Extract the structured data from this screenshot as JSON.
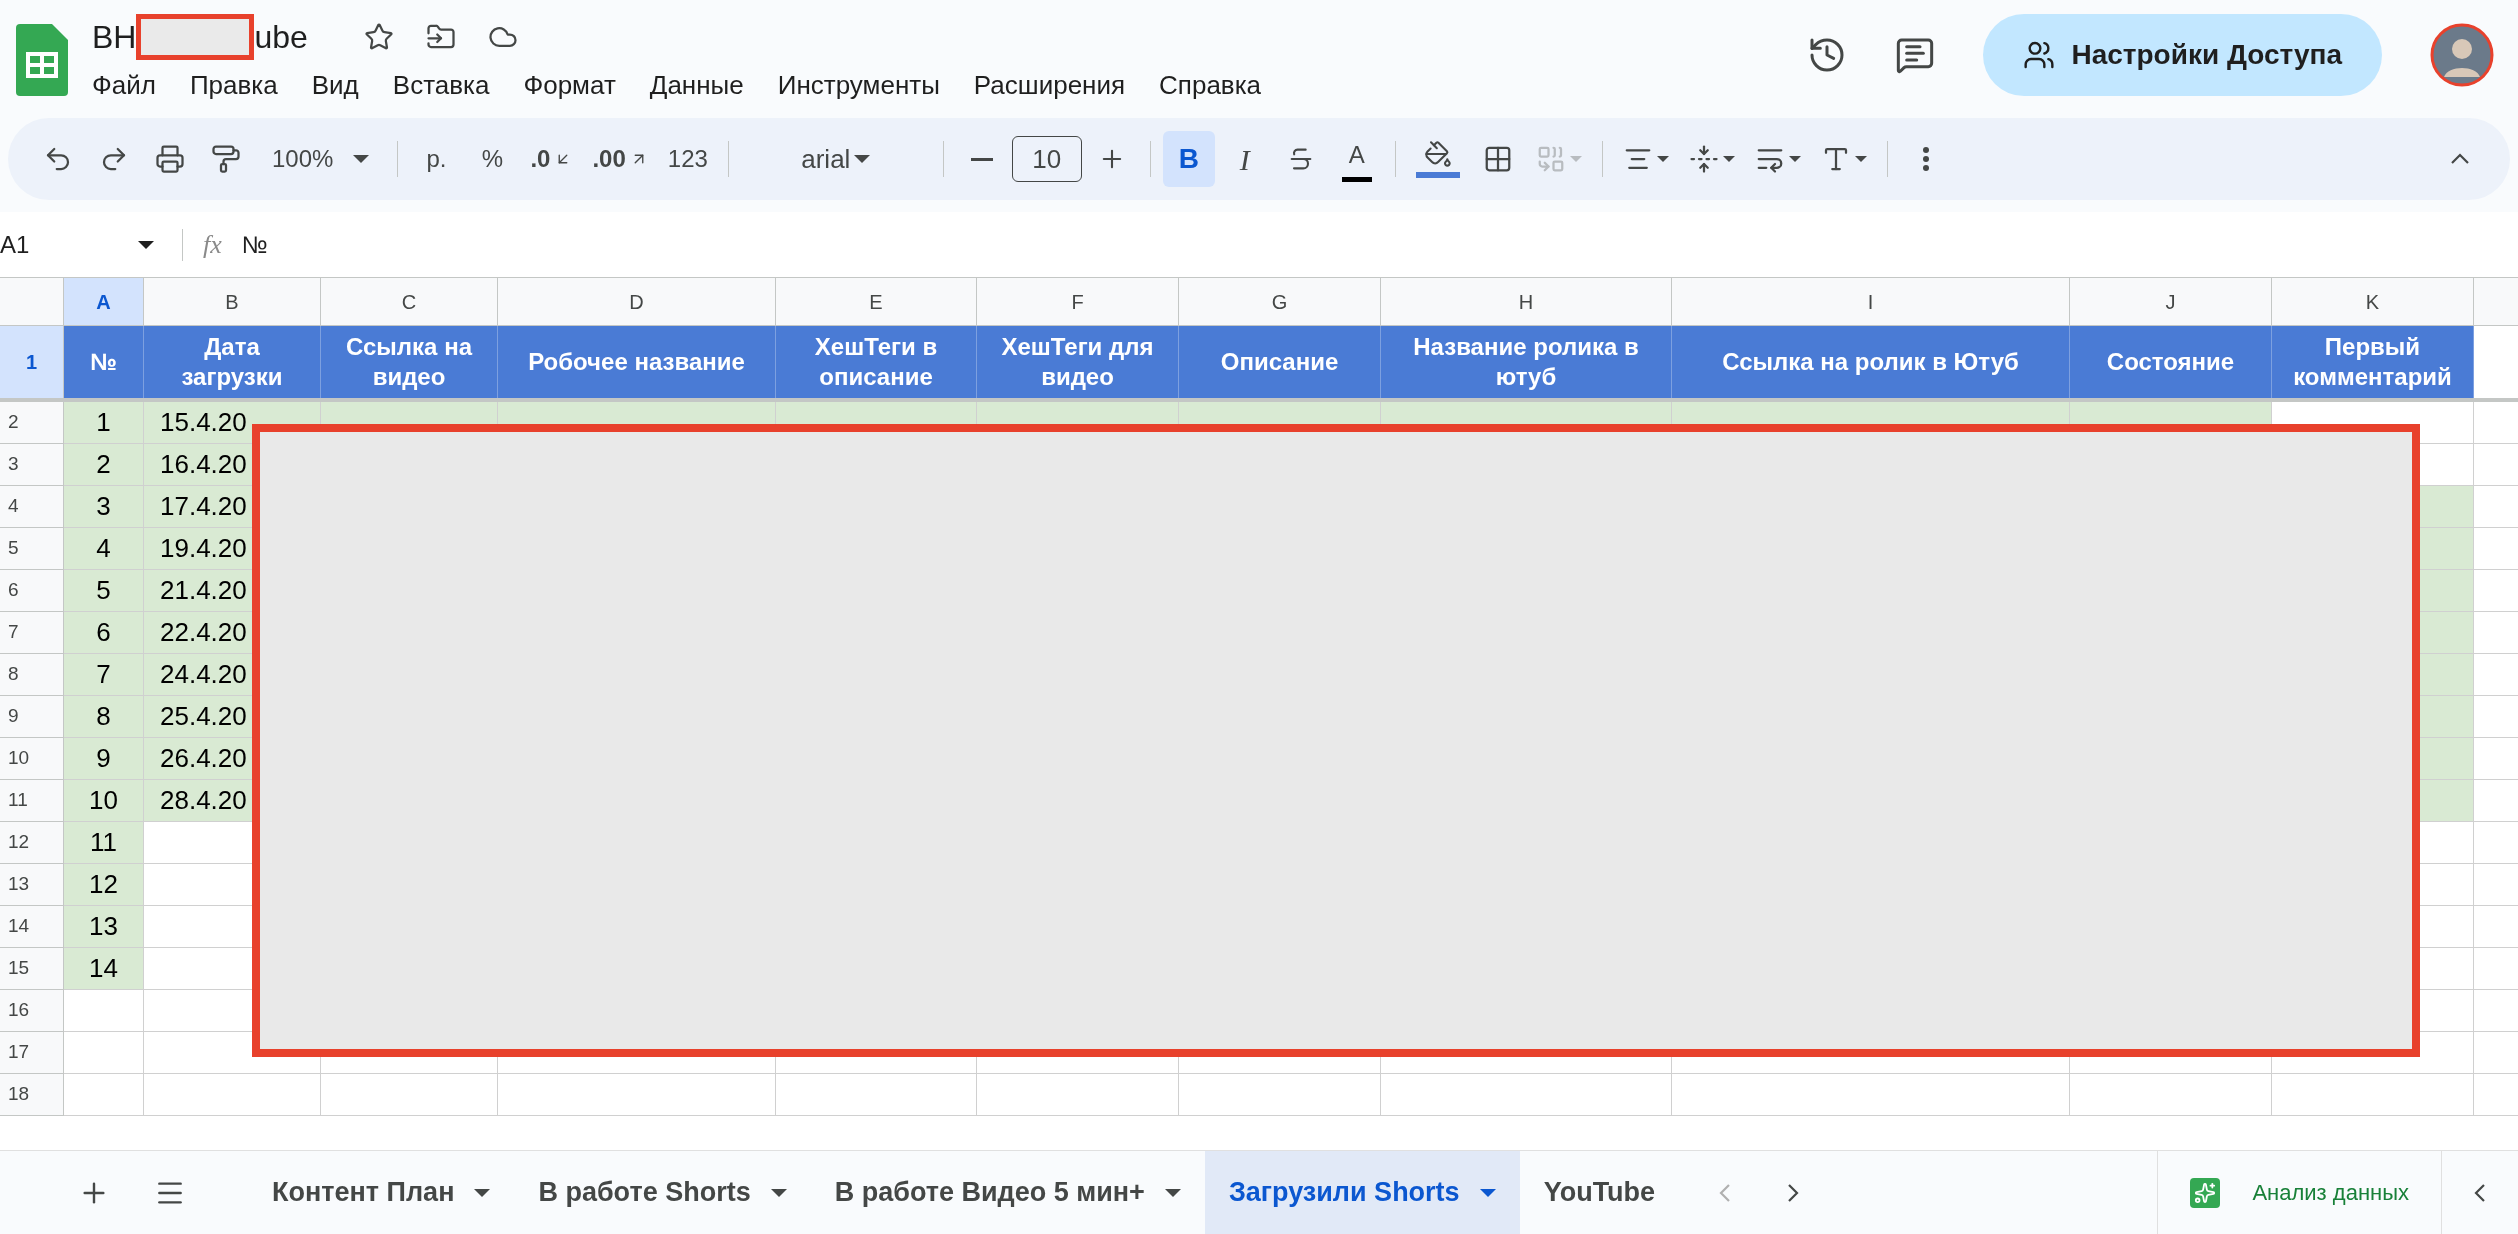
{
  "document": {
    "title_parts": [
      "BH",
      "ube"
    ],
    "redacted": true
  },
  "menu": [
    "Файл",
    "Правка",
    "Вид",
    "Вставка",
    "Формат",
    "Данные",
    "Инструменты",
    "Расширения",
    "Справка"
  ],
  "share_button": "Настройки Доступа",
  "toolbar": {
    "zoom": "100%",
    "currency": "р.",
    "percent": "%",
    "decrease_decimal": ".0",
    "increase_decimal": ".00",
    "number_format": "123",
    "font": "arial",
    "font_size": "10",
    "bold": {
      "label": "B",
      "on": true
    },
    "italic": "I",
    "text_color": "A",
    "merge_disabled": true
  },
  "formula_bar": {
    "cell": "A1",
    "fx": "fx",
    "value": "№"
  },
  "columns": [
    {
      "label": "A",
      "selected": true
    },
    {
      "label": "B",
      "selected": false
    },
    {
      "label": "C",
      "selected": false
    },
    {
      "label": "D",
      "selected": false
    },
    {
      "label": "E",
      "selected": false
    },
    {
      "label": "F",
      "selected": false
    },
    {
      "label": "G",
      "selected": false
    },
    {
      "label": "H",
      "selected": false
    },
    {
      "label": "I",
      "selected": false
    },
    {
      "label": "J",
      "selected": false
    },
    {
      "label": "K",
      "selected": false
    }
  ],
  "header_row": {
    "number": "1",
    "selected": true,
    "cells": [
      "№",
      "Дата загрузки",
      "Ссылка на видео",
      "Робочее название",
      "ХешТеги в описание",
      "ХешТеги для видео",
      "Описание",
      "Название ролика в ютуб",
      "Ссылка на ролик в Ютуб",
      "Состояние",
      "Первый комментарий"
    ]
  },
  "rows": [
    {
      "number": "2",
      "kind": "partial",
      "cells": [
        "1",
        "15.4.20"
      ]
    },
    {
      "number": "3",
      "kind": "partial",
      "cells": [
        "2",
        "16.4.20"
      ]
    },
    {
      "number": "4",
      "kind": "full",
      "cells": [
        "3",
        "17.4.20"
      ]
    },
    {
      "number": "5",
      "kind": "full",
      "cells": [
        "4",
        "19.4.20"
      ]
    },
    {
      "number": "6",
      "kind": "full",
      "cells": [
        "5",
        "21.4.20"
      ]
    },
    {
      "number": "7",
      "kind": "full",
      "cells": [
        "6",
        "22.4.20"
      ]
    },
    {
      "number": "8",
      "kind": "full",
      "cells": [
        "7",
        "24.4.20"
      ]
    },
    {
      "number": "9",
      "kind": "full",
      "cells": [
        "8",
        "25.4.20"
      ]
    },
    {
      "number": "10",
      "kind": "full",
      "cells": [
        "9",
        "26.4.20"
      ]
    },
    {
      "number": "11",
      "kind": "full",
      "cells": [
        "10",
        "28.4.20"
      ]
    },
    {
      "number": "12",
      "kind": "first",
      "cells": [
        "11"
      ]
    },
    {
      "number": "13",
      "kind": "first",
      "cells": [
        "12"
      ]
    },
    {
      "number": "14",
      "kind": "first",
      "cells": [
        "13"
      ]
    },
    {
      "number": "15",
      "kind": "first",
      "cells": [
        "14"
      ]
    },
    {
      "number": "16",
      "kind": "plain",
      "cells": []
    },
    {
      "number": "17",
      "kind": "plain",
      "cells": []
    },
    {
      "number": "18",
      "kind": "plain",
      "cells": []
    }
  ],
  "redaction_box": true,
  "sheet_tabs": [
    {
      "label": "Контент План",
      "selected": false
    },
    {
      "label": "В работе Shorts",
      "selected": false
    },
    {
      "label": "В работе Видео 5 мин+",
      "selected": false
    },
    {
      "label": "Загрузили Shorts",
      "selected": true
    },
    {
      "label": "YouTube",
      "selected": false
    }
  ],
  "explore_button": "Анализ данных"
}
